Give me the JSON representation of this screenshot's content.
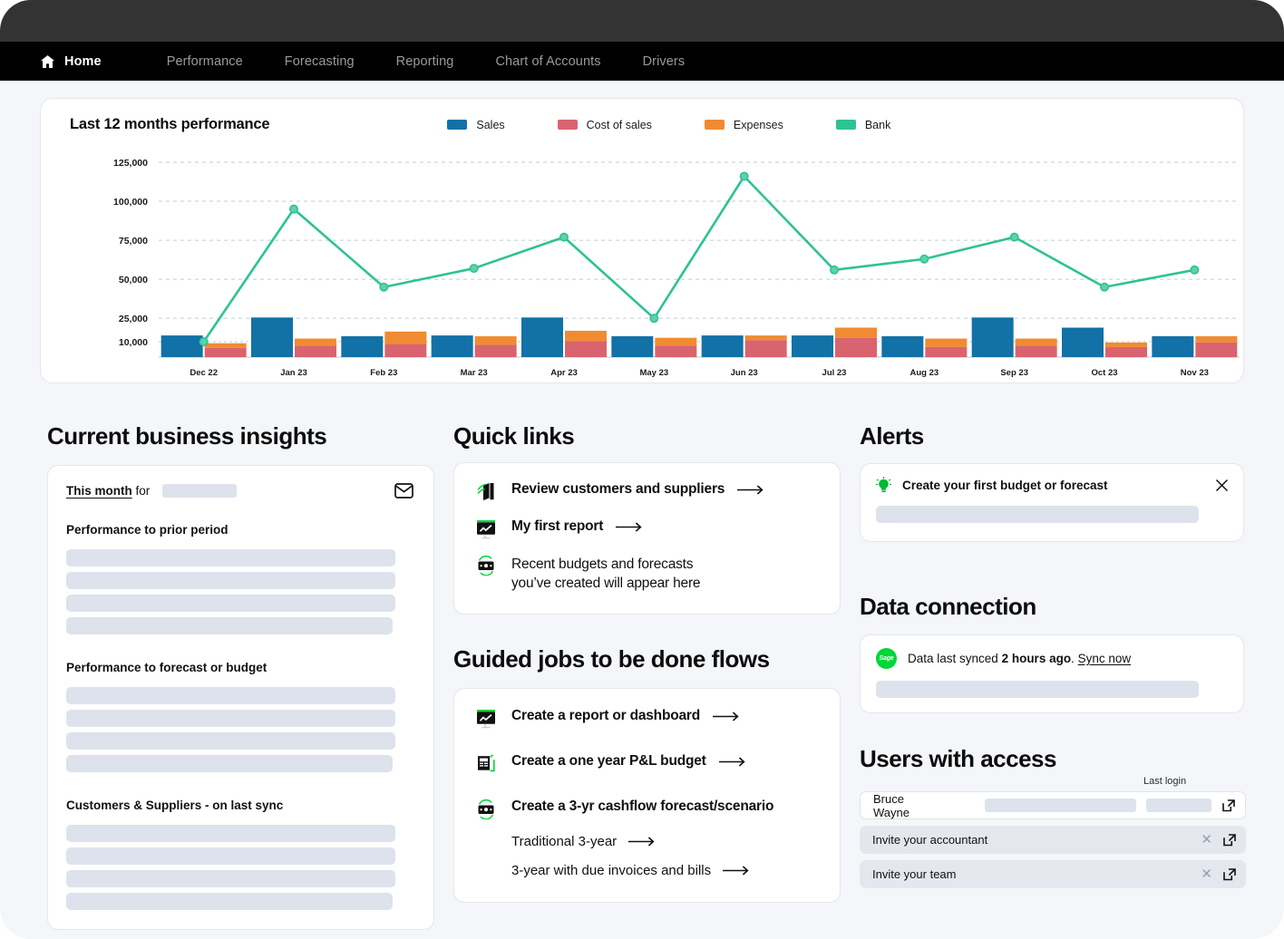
{
  "nav": {
    "home_label": "Home",
    "items": [
      {
        "label": "Performance"
      },
      {
        "label": "Forecasting"
      },
      {
        "label": "Reporting"
      },
      {
        "label": "Chart of  Accounts"
      },
      {
        "label": "Drivers"
      }
    ]
  },
  "chart_card": {
    "title": "Last 12 months performance"
  },
  "chart_data": {
    "type": "bar",
    "title": "Last 12 months performance",
    "xlabel": "",
    "ylabel": "",
    "ylim": [
      0,
      137000
    ],
    "grid": true,
    "legend_position": "top-right",
    "ytick_labels": [
      "125,000",
      "100,000",
      "75,000",
      "50,000",
      "25,000",
      "10,000"
    ],
    "ytick_values": [
      125000,
      100000,
      75000,
      50000,
      25000,
      10000
    ],
    "categories": [
      "Dec 22",
      "Jan 23",
      "Feb 23",
      "Mar 23",
      "Apr 23",
      "May 23",
      "Jun 23",
      "Jul 23",
      "Aug 23",
      "Sep 23",
      "Oct 23",
      "Nov 23"
    ],
    "series": [
      {
        "name": "Sales",
        "type": "bar",
        "color": "#1271a6",
        "values": [
          14000,
          25500,
          13500,
          14000,
          25500,
          13500,
          14000,
          14000,
          13500,
          25500,
          19000,
          13500
        ]
      },
      {
        "name": "Cost of sales",
        "type": "bar-stack",
        "color": "#d9636f",
        "values": [
          6000,
          7500,
          8500,
          8000,
          10500,
          7500,
          11000,
          12500,
          6500,
          7500,
          6500,
          9500
        ]
      },
      {
        "name": "Expenses",
        "type": "bar-stack",
        "color": "#f08b32",
        "values": [
          3000,
          4500,
          8000,
          5500,
          6500,
          5000,
          3000,
          6500,
          5500,
          4500,
          3000,
          4000
        ]
      },
      {
        "name": "Bank",
        "type": "line",
        "color": "#2ec294",
        "values": [
          10000,
          95000,
          45000,
          57000,
          77000,
          25000,
          116000,
          56000,
          63000,
          77000,
          45000,
          56000
        ]
      }
    ]
  },
  "insights": {
    "heading": "Current business insights",
    "period_label": "This month",
    "period_for": "for",
    "mail_icon": "mail-icon",
    "sections": [
      {
        "title": "Performance to prior period",
        "rows": 4
      },
      {
        "title": "Performance to forecast or budget",
        "rows": 4
      },
      {
        "title": "Customers & Suppliers - on last sync",
        "rows": 4
      }
    ]
  },
  "quick_links": {
    "heading": "Quick links",
    "items": [
      {
        "label": "Review customers and suppliers",
        "icon": "customers-icon",
        "arrow": true,
        "bold": true
      },
      {
        "label": "My first report",
        "icon": "report-icon",
        "arrow": true,
        "bold": true
      },
      {
        "label": "Recent budgets and forecasts\nyou’ve created will appear here",
        "icon": "cashflow-icon",
        "arrow": false,
        "bold": false
      }
    ]
  },
  "guided": {
    "heading": "Guided jobs to be done flows",
    "items": [
      {
        "label": "Create a report or dashboard",
        "icon": "report-icon",
        "arrow": true
      },
      {
        "label": "Create a one year P&L budget",
        "icon": "budget-icon",
        "arrow": true
      },
      {
        "label": "Create a 3-yr cashflow forecast/scenario",
        "icon": "cashflow-icon",
        "arrow": false
      }
    ],
    "sublinks": [
      {
        "label": "Traditional 3-year"
      },
      {
        "label": "3-year with due invoices and bills"
      }
    ]
  },
  "alerts": {
    "heading": "Alerts",
    "item": {
      "label": "Create your first budget or forecast",
      "icon": "lightbulb-icon",
      "close": "close-icon"
    }
  },
  "data_connection": {
    "heading": "Data connection",
    "logo_text": "Sage",
    "prefix": "Data last synced ",
    "time": "2 hours ago",
    "suffix": ". ",
    "sync_link": "Sync now"
  },
  "users": {
    "heading": "Users with access",
    "last_login_label": "Last login",
    "rows": [
      {
        "name": "Bruce Wayne",
        "type": "user"
      },
      {
        "name": "Invite your accountant",
        "type": "invite"
      },
      {
        "name": "Invite your team",
        "type": "invite"
      }
    ]
  },
  "colors": {
    "sales": "#1271a6",
    "cost_of_sales": "#d9636f",
    "expenses": "#f08b32",
    "bank": "#2ec294",
    "accent_green": "#00d639",
    "nav_bg": "#000000",
    "page_bg": "#f4f6f9",
    "skeleton": "#dde2ec"
  }
}
